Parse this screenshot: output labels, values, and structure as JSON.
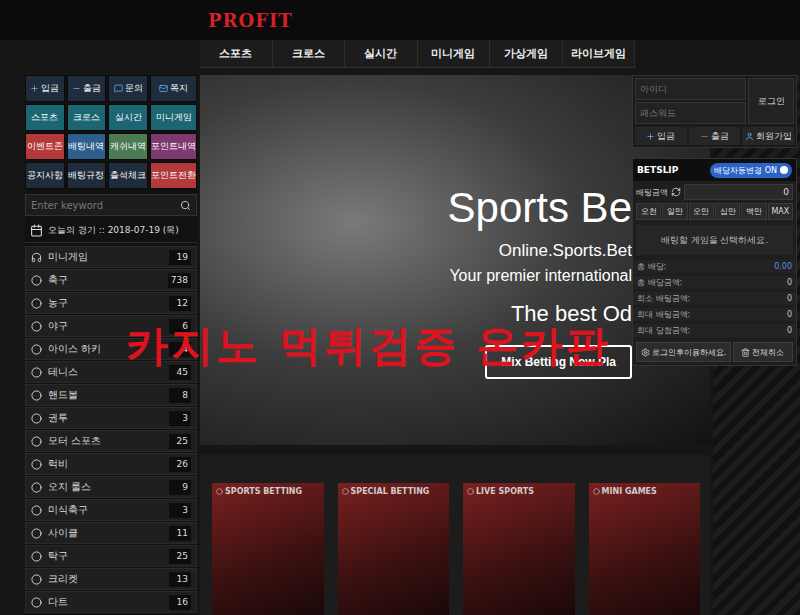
{
  "header": {
    "logo": "PROFIT"
  },
  "nav": [
    "스포츠",
    "크로스",
    "실시간",
    "미니게임",
    "가상게임",
    "라이브게임"
  ],
  "quick_buttons": [
    {
      "label": "입금",
      "color": "#1f2c3b",
      "kind": "icon"
    },
    {
      "label": "출금",
      "color": "#1f2c3b",
      "kind": "icon"
    },
    {
      "label": "문의",
      "color": "#1f2c3b",
      "kind": "icon"
    },
    {
      "label": "쪽지",
      "color": "#1f2c3b",
      "kind": "icon"
    },
    {
      "label": "스포츠",
      "color": "#1c6673",
      "kind": "text"
    },
    {
      "label": "크로스",
      "color": "#1c6673",
      "kind": "text"
    },
    {
      "label": "실시간",
      "color": "#1c6673",
      "kind": "text"
    },
    {
      "label": "미니게임",
      "color": "#1c6673",
      "kind": "text"
    },
    {
      "label": "이벤트존",
      "color": "#b23a3a",
      "kind": "text"
    },
    {
      "label": "배팅내역",
      "color": "#2d5f8c",
      "kind": "text"
    },
    {
      "label": "캐쉬내역",
      "color": "#4b7a55",
      "kind": "text"
    },
    {
      "label": "포인트내역",
      "color": "#7d3a6e",
      "kind": "text"
    },
    {
      "label": "공지사항",
      "color": "#1f2c3b",
      "kind": "text"
    },
    {
      "label": "배팅규정",
      "color": "#1f2c3b",
      "kind": "text"
    },
    {
      "label": "출석체크",
      "color": "#1f2c3b",
      "kind": "text"
    },
    {
      "label": "포인트전환",
      "color": "#b23a3a",
      "kind": "text"
    }
  ],
  "search": {
    "placeholder": "Enter keyword"
  },
  "today": "오늘의 경기 :: 2018-07-19 (목)",
  "sports": [
    {
      "name": "미니게임",
      "count": "19"
    },
    {
      "name": "축구",
      "count": "738"
    },
    {
      "name": "농구",
      "count": "12"
    },
    {
      "name": "야구",
      "count": "6"
    },
    {
      "name": "아이스 하키",
      "count": "4"
    },
    {
      "name": "테니스",
      "count": "45"
    },
    {
      "name": "핸드볼",
      "count": "8"
    },
    {
      "name": "권투",
      "count": "3"
    },
    {
      "name": "모터 스포츠",
      "count": "25"
    },
    {
      "name": "럭비",
      "count": "26"
    },
    {
      "name": "오지 룰스",
      "count": "9"
    },
    {
      "name": "미식축구",
      "count": "3"
    },
    {
      "name": "사이클",
      "count": "11"
    },
    {
      "name": "탁구",
      "count": "25"
    },
    {
      "name": "크리켓",
      "count": "13"
    },
    {
      "name": "다트",
      "count": "16"
    }
  ],
  "banner": {
    "title": "Sports Be",
    "subtitle": "Online.Sports.Bet",
    "tagline": "Your premier international",
    "headline": "The best Od",
    "button": "Mix Betting Now Pla"
  },
  "watermark": "카지노 먹튀검증 온카판",
  "cards": [
    "SPORTS BETTING",
    "SPECIAL BETTING",
    "LIVE SPORTS",
    "MINI GAMES"
  ],
  "login": {
    "id_placeholder": "아이디",
    "password_placeholder": "패스워드",
    "button": "로그인",
    "actions": [
      "입금",
      "출금",
      "회원가입"
    ]
  },
  "betslip": {
    "title": "BETSLIP",
    "auto_odds": {
      "label": "배당자동변경 ON",
      "on": true
    },
    "amount_label": "배팅금액",
    "amount": "0",
    "quick_amounts": [
      "오천",
      "일만",
      "오만",
      "십만",
      "백만",
      "MAX"
    ],
    "message": "배팅할 게임을 선택하세요.",
    "summary": [
      {
        "label": "총 배당:",
        "value": "0.00"
      },
      {
        "label": "총 배당금액:",
        "value": "0"
      },
      {
        "label": "최소 배팅금액:",
        "value": "0"
      },
      {
        "label": "최대 배팅금액:",
        "value": "0"
      },
      {
        "label": "최대 당첨금액:",
        "value": "0"
      }
    ],
    "buttons": [
      "로그인후이용하세요.",
      "전체취소"
    ]
  }
}
